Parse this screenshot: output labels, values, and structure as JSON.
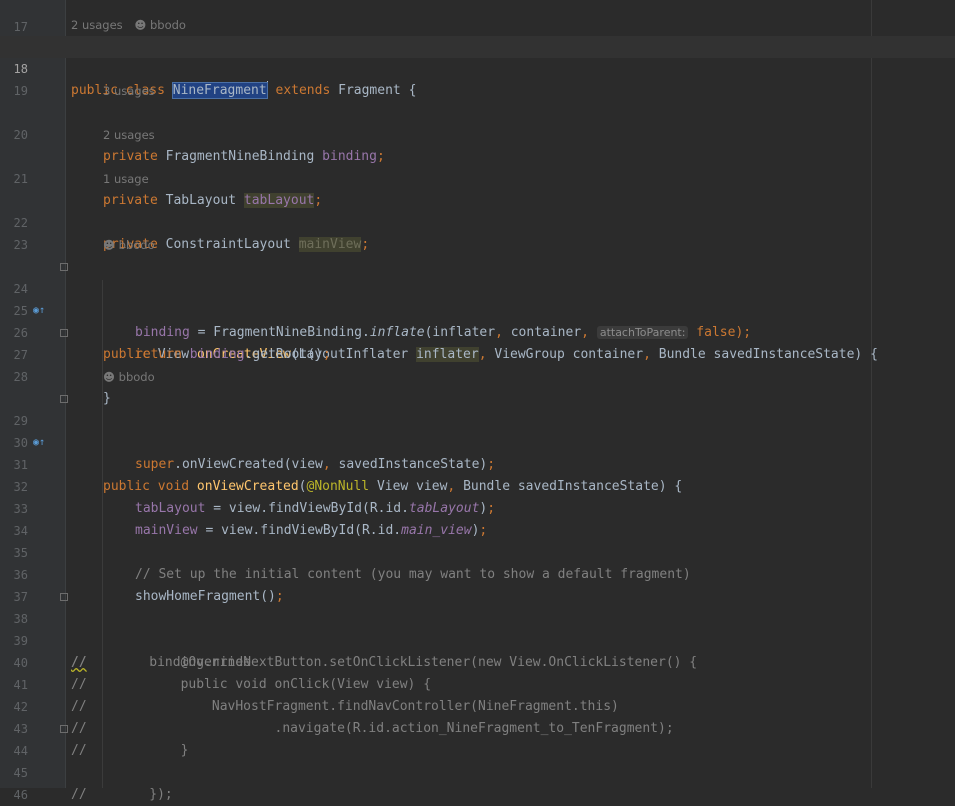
{
  "hints": {
    "class_usages": "2 usages",
    "class_author": "bbodo",
    "binding_usages": "3 usages",
    "tablayout_usages": "2 usages",
    "mainview_usages": "1 usage",
    "oncreateview_author": "bbodo",
    "onviewcreated_author": "bbodo"
  },
  "param_hint": "attachToParent:",
  "line_numbers": [
    "17",
    "18",
    "19",
    "20",
    "21",
    "22",
    "23",
    "24",
    "25",
    "26",
    "27",
    "28",
    "29",
    "30",
    "31",
    "32",
    "33",
    "34",
    "35",
    "36",
    "37",
    "38",
    "39",
    "40",
    "41",
    "42",
    "43",
    "44",
    "45",
    "46"
  ],
  "code": {
    "l18": {
      "kw1": "public class ",
      "cls": "NineFragment",
      "kw2": "extends ",
      "base": "Fragment {"
    },
    "l20": {
      "kw": "private ",
      "type": "FragmentNineBinding ",
      "fld": "binding",
      "end": ";"
    },
    "l21": {
      "kw": "private ",
      "type": "TabLayout ",
      "fld": "tabLayout",
      "end": ";"
    },
    "l22": {
      "kw": "private ",
      "type": "ConstraintLayout ",
      "fld": "mainView",
      "end": ";"
    },
    "l24": {
      "kw": "public ",
      "type": "View ",
      "fn": "onCreateView",
      "p1": "(LayoutInflater ",
      "inflater": "inflater",
      "comma1": ", ",
      "p2": "ViewGroup container",
      "comma2": ", ",
      "p3": "Bundle savedInstanceState) {"
    },
    "l25": {
      "fld": "binding",
      "mid": " = FragmentNineBinding.",
      "call": "inflate",
      "args": "(inflater",
      "c1": ", ",
      "arg2": "container",
      "c2": ", ",
      "val": "false",
      "end": ");"
    },
    "l26": {
      "kw": "return ",
      "fld": "binding",
      "rest": ".getRoot()",
      "end": ";"
    },
    "l27": "}",
    "l29": {
      "kw": "public void ",
      "fn": "onViewCreated",
      "p": "(",
      "ann": "@NonNull",
      "rest": " View view",
      "comma": ", ",
      "p2": "Bundle savedInstanceState) {"
    },
    "l30": {
      "kw": "super",
      "rest": ".onViewCreated(view",
      "comma": ", ",
      "p2": "savedInstanceState)",
      "end": ";"
    },
    "l32": {
      "fld": "tabLayout",
      "mid": " = view.findViewById(R.id.",
      "id": "tabLayout",
      "end1": ")",
      "end2": ";"
    },
    "l33": {
      "fld": "mainView",
      "mid": " = view.findViewById(R.id.",
      "id": "main_view",
      "end1": ")",
      "end2": ";"
    },
    "l35": "// Set up the initial content (you may want to show a default fragment)",
    "l36": {
      "call": "showHomeFragment()",
      "end": ";"
    },
    "l38": {
      "slashes": "//",
      "text": "        binding.nineNextButton.setOnClickListener(new View.OnClickListener() {"
    },
    "l39": "//            @Override",
    "l40": "//            public void onClick(View view) {",
    "l41": "//                NavHostFragment.findNavController(NineFragment.this)",
    "l42": "//                        .navigate(R.id.action_NineFragment_to_TenFragment);",
    "l43": "//            }",
    "l44": "//        });"
  },
  "icons": {
    "override": "override-up-arrow-icon",
    "fold": "fold-marker-icon",
    "user": "user-icon"
  }
}
